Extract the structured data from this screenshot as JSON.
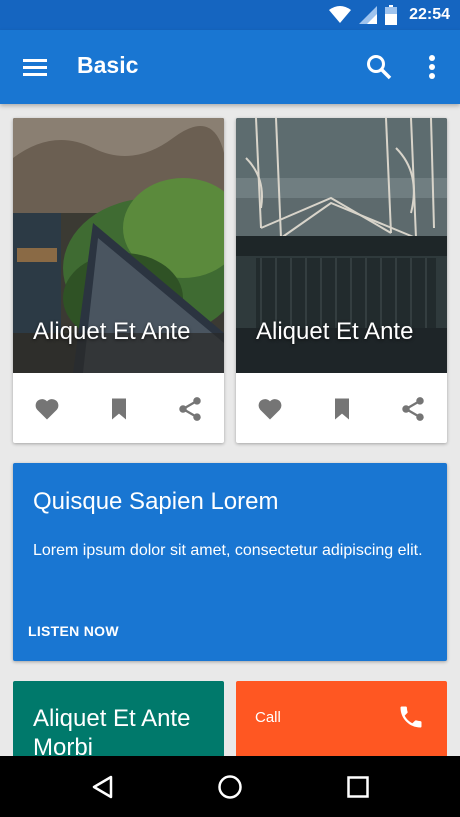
{
  "status_bar": {
    "time": "22:54",
    "icons": [
      "wifi-icon",
      "signal-icon",
      "battery-icon"
    ]
  },
  "app_bar": {
    "title": "Basic",
    "icons": [
      "menu-icon",
      "search-icon",
      "more-vert-icon"
    ]
  },
  "image_cards": [
    {
      "title": "Aliquet Et Ante",
      "actions": [
        "favorite-icon",
        "bookmark-icon",
        "share-icon"
      ]
    },
    {
      "title": "Aliquet Et Ante",
      "actions": [
        "favorite-icon",
        "bookmark-icon",
        "share-icon"
      ]
    }
  ],
  "feature_card": {
    "heading": "Quisque Sapien Lorem",
    "body": "Lorem ipsum dolor sit amet, consectetur adipiscing elit.",
    "action": "LISTEN NOW",
    "color": "#1976d2"
  },
  "small_cards": {
    "green": {
      "text": "Aliquet Et Ante Morbi",
      "color": "#00796b"
    },
    "orange": {
      "label": "Call",
      "icon": "phone-icon",
      "color": "#ff5722"
    }
  },
  "nav_bar": {
    "buttons": [
      "back-icon",
      "home-icon",
      "recents-icon"
    ]
  },
  "colors": {
    "primary": "#1976d2",
    "primary_dark": "#1565c0",
    "icon_gray": "#757575"
  }
}
